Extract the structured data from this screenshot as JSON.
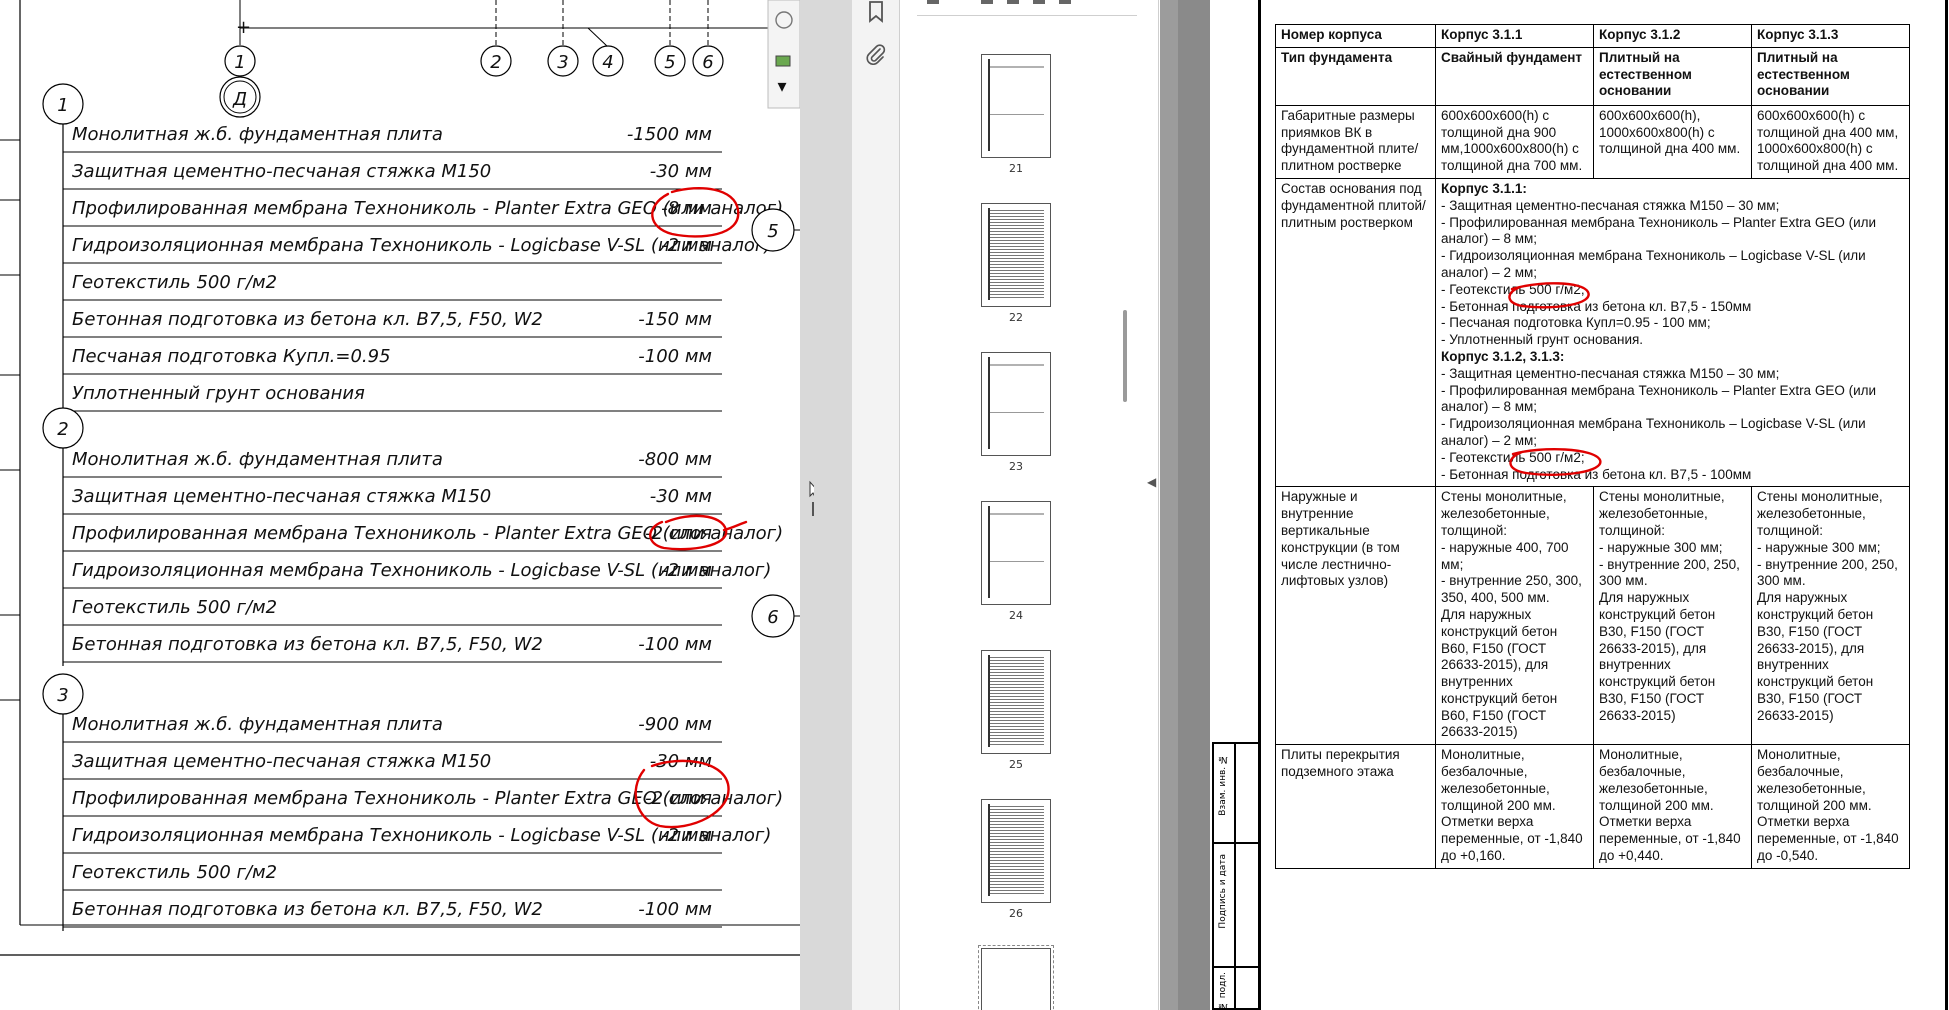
{
  "drawing": {
    "grid_axes": [
      "1",
      "2",
      "3",
      "4",
      "5",
      "6"
    ],
    "row_axis": "Д",
    "section_callouts": [
      "5",
      "6"
    ],
    "types": [
      {
        "marker": "1",
        "layers": [
          {
            "name": "Монолитная ж.б. фундаментная плита",
            "value": "-1500 мм"
          },
          {
            "name": "Защитная цементно-песчаная стяжка М150",
            "value": "-30 мм"
          },
          {
            "name": "Профилированная мембрана Технониколь - Planter Extra GEO (или аналог)",
            "value": "-8 мм"
          },
          {
            "name": "Гидроизоляционная мембрана Технониколь - Logicbase V-SL (или аналог)",
            "value": "-2 мм"
          },
          {
            "name": "Геотекстиль 500 г/м2",
            "value": ""
          },
          {
            "name": "Бетонная подготовка из бетона кл. В7,5, F50, W2",
            "value": "-150 мм"
          },
          {
            "name": "Песчаная подготовка Купл.=0.95",
            "value": "-100 мм"
          },
          {
            "name": "Уплотненный грунт основания",
            "value": ""
          }
        ]
      },
      {
        "marker": "2",
        "layers": [
          {
            "name": "Монолитная ж.б. фундаментная плита",
            "value": "-800 мм"
          },
          {
            "name": "Защитная цементно-песчаная стяжка М150",
            "value": "-30 мм"
          },
          {
            "name": "Профилированная мембрана Технониколь - Planter Extra GEO (или аналог)",
            "value": "-2 слоя"
          },
          {
            "name": "Гидроизоляционная мембрана Технониколь - Logicbase V-SL (или аналог)",
            "value": "-2 мм"
          },
          {
            "name": "Геотекстиль 500 г/м2",
            "value": ""
          },
          {
            "name": "Бетонная подготовка из бетона кл. В7,5, F50, W2",
            "value": "-100 мм"
          }
        ]
      },
      {
        "marker": "3",
        "layers": [
          {
            "name": "Монолитная ж.б. фундаментная плита",
            "value": "-900 мм"
          },
          {
            "name": "Защитная цементно-песчаная стяжка М150",
            "value": "-30 мм"
          },
          {
            "name": "Профилированная мембрана Технониколь - Planter Extra GEO (или аналог)",
            "value": "-2 слоя"
          },
          {
            "name": "Гидроизоляционная мембрана Технониколь - Logicbase V-SL (или аналог)",
            "value": "-2 мм"
          },
          {
            "name": "Геотекстиль 500 г/м2",
            "value": ""
          },
          {
            "name": "Бетонная подготовка из бетона кл. В7,5, F50, W2",
            "value": "-100 мм"
          }
        ]
      }
    ]
  },
  "viewer": {
    "thumb_pages": [
      "21",
      "22",
      "23",
      "24",
      "25",
      "26"
    ],
    "side_icons": [
      "bookmark-icon",
      "paperclip-icon"
    ]
  },
  "page": {
    "stamp_labels": [
      "Взам. инв. №",
      "Подпись и дата",
      "Инв. № подл."
    ],
    "table": {
      "r1": {
        "c1": "Номер корпуса",
        "c2": "Корпус 3.1.1",
        "c3": "Корпус 3.1.2",
        "c4": "Корпус 3.1.3"
      },
      "r2": {
        "c1": "Тип фундамента",
        "c2": "Свайный фундамент",
        "c3": "Плитный на естественном основании",
        "c4": "Плитный на естественном основании"
      },
      "r3": {
        "c1": "Габаритные размеры приямков ВК в фундаментной плите/плитном ростверке",
        "c2": "600x600x600(h) с толщиной дна 900 мм,1000x600x800(h) с толщиной дна 700 мм.",
        "c3": "600x600x600(h), 1000x600x800(h) с толщиной дна 400 мм.",
        "c4": "600x600x600(h) с толщиной дна 400 мм, 1000x600x800(h) с толщиной дна 400 мм."
      },
      "r4": {
        "c1": "Состав основания под фундаментной плитой/плитным ростверком",
        "h1": "Корпус 3.1.1:",
        "lines1": "- Защитная цементно-песчаная стяжка М150 – 30 мм;\n- Профилированная мембрана Технониколь – Planter Extra GEO (или аналог) – 8 мм;\n- Гидроизоляционная мембрана Технониколь – Logicbase V-SL (или аналог) – 2 мм;\n- Геотекстиль 500 г/м2;\n- Бетонная подготовка из бетона кл. В7,5 - 150мм\n- Песчаная подготовка Купл=0.95 - 100 мм;\n- Уплотненный грунт основания.",
        "h2": "Корпус 3.1.2, 3.1.3:",
        "lines2": "- Защитная цементно-песчаная стяжка М150 – 30 мм;\n- Профилированная мембрана Технониколь – Planter Extra GEO (или аналог) – 8 мм;\n- Гидроизоляционная мембрана Технониколь – Logicbase V-SL (или аналог) – 2 мм;\n- Геотекстиль 500 г/м2;\n- Бетонная подготовка из бетона кл. В7,5 - 100мм"
      },
      "r5": {
        "c1": "Наружные и внутренние вертикальные конструкции (в том числе лестнично-лифтовых узлов)",
        "c2": "Стены монолитные, железобетонные, толщиной:\n- наружные 400, 700 мм;\n- внутренние 250, 300, 350, 400, 500 мм.\nДля наружных конструкций бетон В60, F150 (ГОСТ 26633-2015), для внутренних конструкций бетон В60, F150 (ГОСТ 26633-2015)",
        "c3": "Стены монолитные, железобетонные, толщиной:\n- наружные 300 мм;\n- внутренние 200, 250, 300 мм.\nДля наружных конструкций бетон В30, F150 (ГОСТ 26633-2015), для внутренних конструкций бетон В30, F150 (ГОСТ 26633-2015)",
        "c4": "Стены монолитные, железобетонные, толщиной:\n- наружные 300 мм;\n- внутренние 200, 250, 300 мм.\nДля наружных конструкций бетон В30, F150 (ГОСТ 26633-2015), для внутренних конструкций бетон В30, F150 (ГОСТ 26633-2015)"
      },
      "r6": {
        "c1": "Плиты перекрытия подземного этажа",
        "c2": "Монолитные, безбалочные, железобетонные, толщиной 200 мм. Отметки верха переменные, от -1,840 до +0,160.",
        "c3": "Монолитные, безбалочные, железобетонные, толщиной 200 мм. Отметки верха переменные, от -1,840 до +0,440.",
        "c4": "Монолитные, безбалочные, железобетонные, толщиной 200 мм. Отметки верха переменные, от -1,840 до -0,540."
      }
    }
  },
  "colors": {
    "markup": "#e00000",
    "gutter": "#8a8a8a",
    "panel": "#d9d9d9"
  }
}
